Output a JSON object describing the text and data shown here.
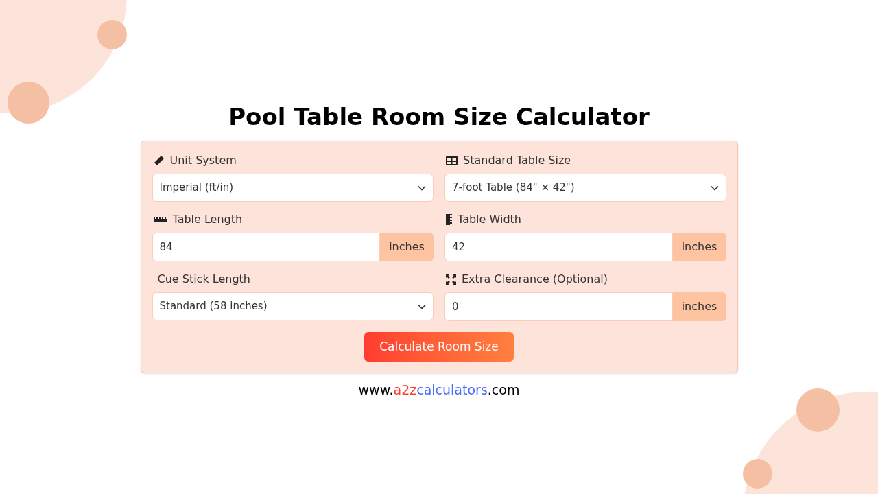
{
  "title": "Pool Table Room Size Calculator",
  "fields": [
    {
      "kind": "select",
      "label": "Unit System",
      "value": "Imperial (ft/in)"
    },
    {
      "kind": "select",
      "label": "Standard Table Size",
      "value": "7-foot Table (84\" × 42\")"
    },
    {
      "kind": "number",
      "label": "Table Length",
      "value": "84",
      "unit": "inches"
    },
    {
      "kind": "number",
      "label": "Table Width",
      "value": "42",
      "unit": "inches"
    },
    {
      "kind": "select",
      "label": "Cue Stick Length",
      "value": "Standard (58 inches)"
    },
    {
      "kind": "number",
      "label": "Extra Clearance (Optional)",
      "value": "0",
      "unit": "inches"
    }
  ],
  "button": "Calculate Room Size",
  "footer": [
    {
      "text": "www.",
      "color": "#000000"
    },
    {
      "text": "a2z",
      "color": "#ff3b30"
    },
    {
      "text": "calculators",
      "color": "#4a6cf7"
    },
    {
      "text": ".com",
      "color": "#000000"
    }
  ]
}
